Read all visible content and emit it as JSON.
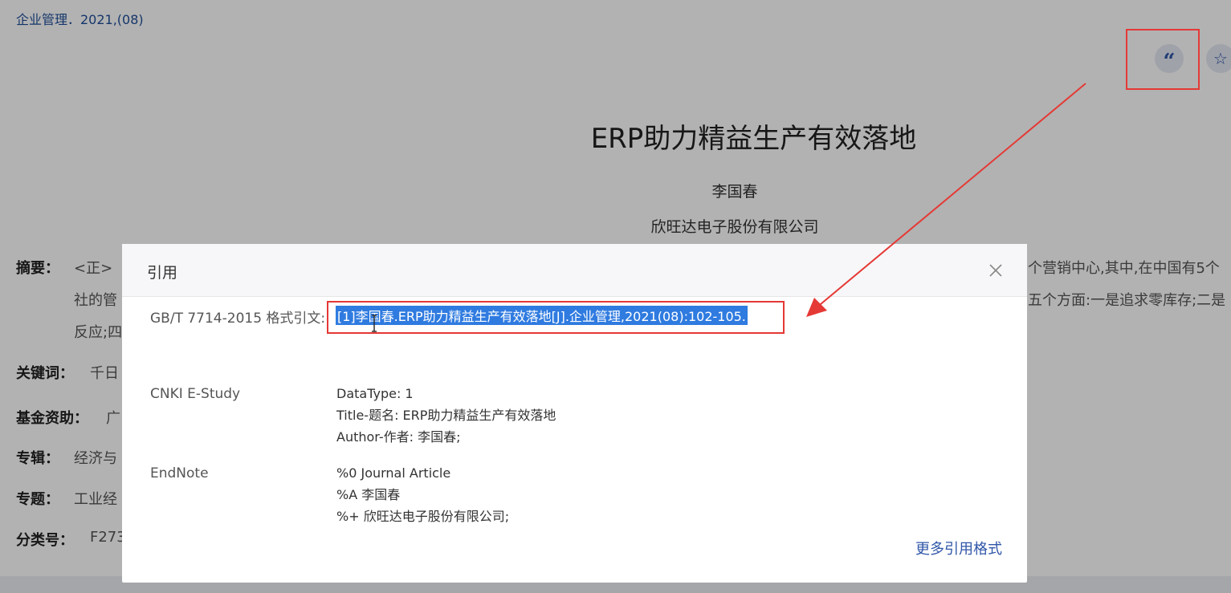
{
  "page": {
    "source": "企业管理．2021,(08)",
    "title": "ERP助力精益生产有效落地",
    "author": "李国春",
    "organization": "欣旺达电子股份有限公司",
    "quote_icon_glyph": "“",
    "star_icon_glyph": "☆",
    "meta": {
      "abstract_label": "摘要：",
      "abstract_line1": "<正>",
      "abstract_line2": "社的管",
      "abstract_line3": "反应;四",
      "abstract_right1": "个营销中心,其中,在中国有5个",
      "abstract_right2": "五个方面:一是追求零库存;二是",
      "keywords_label": "关键词：",
      "keywords_value": "千日",
      "funding_label": "基金资助：",
      "funding_value": "广",
      "album_label": "专辑：",
      "album_value": "经济与",
      "topic_label": "专题：",
      "topic_value": "工业经",
      "class_label": "分类号：",
      "class_value": "F273"
    }
  },
  "dialog": {
    "title": "引用",
    "close_icon": "close-icon",
    "gb_label": "GB/T 7714-2015 格式引文:",
    "gb_citation": "[1]李国春.ERP助力精益生产有效落地[J].企业管理,2021(08):102-105.",
    "estudy_label": "CNKI E-Study",
    "estudy_lines": [
      "DataType: 1",
      "Title-题名: ERP助力精益生产有效落地",
      "Author-作者: 李国春;"
    ],
    "endnote_label": "EndNote",
    "endnote_lines": [
      "%0 Journal Article",
      "%A 李国春",
      "%+ 欣旺达电子股份有限公司;"
    ],
    "more_formats": "更多引用格式"
  },
  "colors": {
    "link_blue": "#2f56a8",
    "selection_blue": "#2f7be0",
    "annotation_red": "#e53935"
  }
}
